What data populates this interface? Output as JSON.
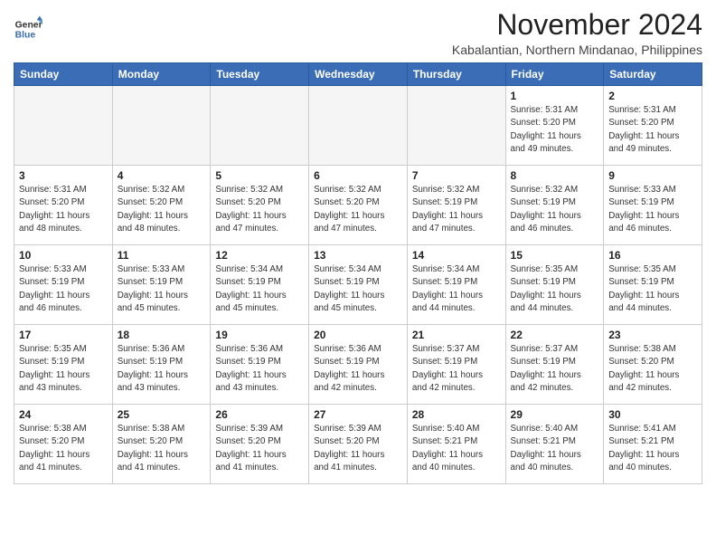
{
  "logo": {
    "line1": "General",
    "line2": "Blue"
  },
  "title": "November 2024",
  "location": "Kabalantian, Northern Mindanao, Philippines",
  "weekdays": [
    "Sunday",
    "Monday",
    "Tuesday",
    "Wednesday",
    "Thursday",
    "Friday",
    "Saturday"
  ],
  "weeks": [
    [
      {
        "day": "",
        "info": ""
      },
      {
        "day": "",
        "info": ""
      },
      {
        "day": "",
        "info": ""
      },
      {
        "day": "",
        "info": ""
      },
      {
        "day": "",
        "info": ""
      },
      {
        "day": "1",
        "info": "Sunrise: 5:31 AM\nSunset: 5:20 PM\nDaylight: 11 hours\nand 49 minutes."
      },
      {
        "day": "2",
        "info": "Sunrise: 5:31 AM\nSunset: 5:20 PM\nDaylight: 11 hours\nand 49 minutes."
      }
    ],
    [
      {
        "day": "3",
        "info": "Sunrise: 5:31 AM\nSunset: 5:20 PM\nDaylight: 11 hours\nand 48 minutes."
      },
      {
        "day": "4",
        "info": "Sunrise: 5:32 AM\nSunset: 5:20 PM\nDaylight: 11 hours\nand 48 minutes."
      },
      {
        "day": "5",
        "info": "Sunrise: 5:32 AM\nSunset: 5:20 PM\nDaylight: 11 hours\nand 47 minutes."
      },
      {
        "day": "6",
        "info": "Sunrise: 5:32 AM\nSunset: 5:20 PM\nDaylight: 11 hours\nand 47 minutes."
      },
      {
        "day": "7",
        "info": "Sunrise: 5:32 AM\nSunset: 5:19 PM\nDaylight: 11 hours\nand 47 minutes."
      },
      {
        "day": "8",
        "info": "Sunrise: 5:32 AM\nSunset: 5:19 PM\nDaylight: 11 hours\nand 46 minutes."
      },
      {
        "day": "9",
        "info": "Sunrise: 5:33 AM\nSunset: 5:19 PM\nDaylight: 11 hours\nand 46 minutes."
      }
    ],
    [
      {
        "day": "10",
        "info": "Sunrise: 5:33 AM\nSunset: 5:19 PM\nDaylight: 11 hours\nand 46 minutes."
      },
      {
        "day": "11",
        "info": "Sunrise: 5:33 AM\nSunset: 5:19 PM\nDaylight: 11 hours\nand 45 minutes."
      },
      {
        "day": "12",
        "info": "Sunrise: 5:34 AM\nSunset: 5:19 PM\nDaylight: 11 hours\nand 45 minutes."
      },
      {
        "day": "13",
        "info": "Sunrise: 5:34 AM\nSunset: 5:19 PM\nDaylight: 11 hours\nand 45 minutes."
      },
      {
        "day": "14",
        "info": "Sunrise: 5:34 AM\nSunset: 5:19 PM\nDaylight: 11 hours\nand 44 minutes."
      },
      {
        "day": "15",
        "info": "Sunrise: 5:35 AM\nSunset: 5:19 PM\nDaylight: 11 hours\nand 44 minutes."
      },
      {
        "day": "16",
        "info": "Sunrise: 5:35 AM\nSunset: 5:19 PM\nDaylight: 11 hours\nand 44 minutes."
      }
    ],
    [
      {
        "day": "17",
        "info": "Sunrise: 5:35 AM\nSunset: 5:19 PM\nDaylight: 11 hours\nand 43 minutes."
      },
      {
        "day": "18",
        "info": "Sunrise: 5:36 AM\nSunset: 5:19 PM\nDaylight: 11 hours\nand 43 minutes."
      },
      {
        "day": "19",
        "info": "Sunrise: 5:36 AM\nSunset: 5:19 PM\nDaylight: 11 hours\nand 43 minutes."
      },
      {
        "day": "20",
        "info": "Sunrise: 5:36 AM\nSunset: 5:19 PM\nDaylight: 11 hours\nand 42 minutes."
      },
      {
        "day": "21",
        "info": "Sunrise: 5:37 AM\nSunset: 5:19 PM\nDaylight: 11 hours\nand 42 minutes."
      },
      {
        "day": "22",
        "info": "Sunrise: 5:37 AM\nSunset: 5:19 PM\nDaylight: 11 hours\nand 42 minutes."
      },
      {
        "day": "23",
        "info": "Sunrise: 5:38 AM\nSunset: 5:20 PM\nDaylight: 11 hours\nand 42 minutes."
      }
    ],
    [
      {
        "day": "24",
        "info": "Sunrise: 5:38 AM\nSunset: 5:20 PM\nDaylight: 11 hours\nand 41 minutes."
      },
      {
        "day": "25",
        "info": "Sunrise: 5:38 AM\nSunset: 5:20 PM\nDaylight: 11 hours\nand 41 minutes."
      },
      {
        "day": "26",
        "info": "Sunrise: 5:39 AM\nSunset: 5:20 PM\nDaylight: 11 hours\nand 41 minutes."
      },
      {
        "day": "27",
        "info": "Sunrise: 5:39 AM\nSunset: 5:20 PM\nDaylight: 11 hours\nand 41 minutes."
      },
      {
        "day": "28",
        "info": "Sunrise: 5:40 AM\nSunset: 5:21 PM\nDaylight: 11 hours\nand 40 minutes."
      },
      {
        "day": "29",
        "info": "Sunrise: 5:40 AM\nSunset: 5:21 PM\nDaylight: 11 hours\nand 40 minutes."
      },
      {
        "day": "30",
        "info": "Sunrise: 5:41 AM\nSunset: 5:21 PM\nDaylight: 11 hours\nand 40 minutes."
      }
    ]
  ]
}
